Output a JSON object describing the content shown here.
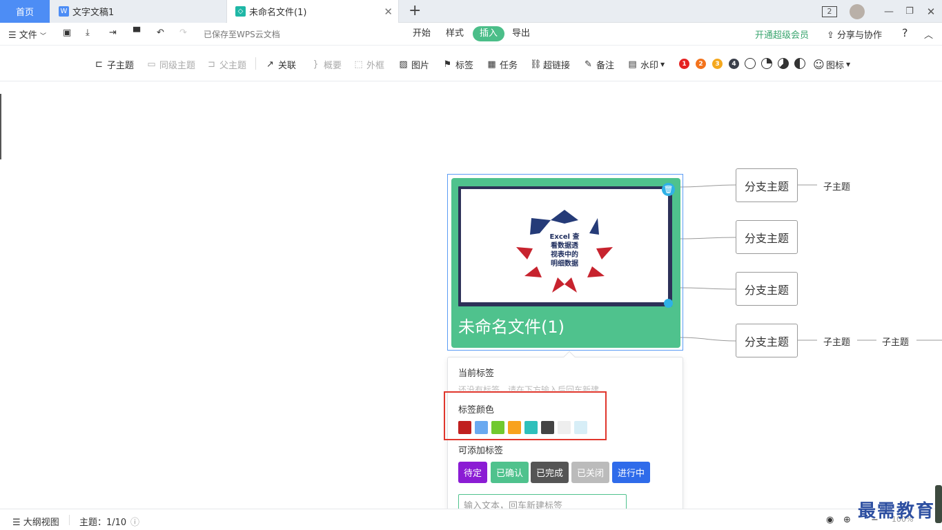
{
  "tabs": {
    "home": "首页",
    "doc": "文字文稿1",
    "active": "未命名文件(1)",
    "page_count": "2"
  },
  "menu": {
    "file": "文件",
    "saved_status": "已保存至WPS云文档",
    "tabs": [
      "开始",
      "样式",
      "插入",
      "导出"
    ],
    "vip": "开通超级会员",
    "share": "分享与协作",
    "help": "?"
  },
  "toolbar": {
    "subtopic": "子主题",
    "sibling": "同级主题",
    "parent": "父主题",
    "relation": "关联",
    "summary": "概要",
    "boundary": "外框",
    "image": "图片",
    "tag": "标签",
    "task": "任务",
    "link": "超链接",
    "note": "备注",
    "watermark": "水印",
    "icon": "图标",
    "priorities": [
      "1",
      "2",
      "3",
      "4"
    ]
  },
  "mindmap": {
    "central_title": "未命名文件(1)",
    "image_text": [
      "Excel 查",
      "看数据透",
      "视表中的",
      "明细数据"
    ],
    "branches": [
      "分支主题",
      "分支主题",
      "分支主题",
      "分支主题"
    ],
    "subtopics": [
      "子主题",
      "子主题",
      "子主题"
    ]
  },
  "tag_panel": {
    "current_label": "当前标签",
    "empty_hint": "还没有标签，请在下方输入后回车新建",
    "color_label": "标签颜色",
    "colors": [
      "#c0201f",
      "#6aa9f0",
      "#71c92e",
      "#f8a21d",
      "#2ec0bb",
      "#444444",
      "#eeeeee",
      "#d7eef7"
    ],
    "addable_label": "可添加标签",
    "tags": [
      {
        "label": "待定",
        "color": "#8b1cd4"
      },
      {
        "label": "已确认",
        "color": "#4fc28d"
      },
      {
        "label": "已完成",
        "color": "#555555"
      },
      {
        "label": "已关闭",
        "color": "#bbbbbb"
      },
      {
        "label": "进行中",
        "color": "#2f6bea"
      }
    ],
    "input_placeholder": "输入文本，回车新建标签"
  },
  "status": {
    "outline": "大纲视图",
    "topic_count": "主题：1/10",
    "zoom": "100%"
  },
  "watermark_text": "最需教育"
}
